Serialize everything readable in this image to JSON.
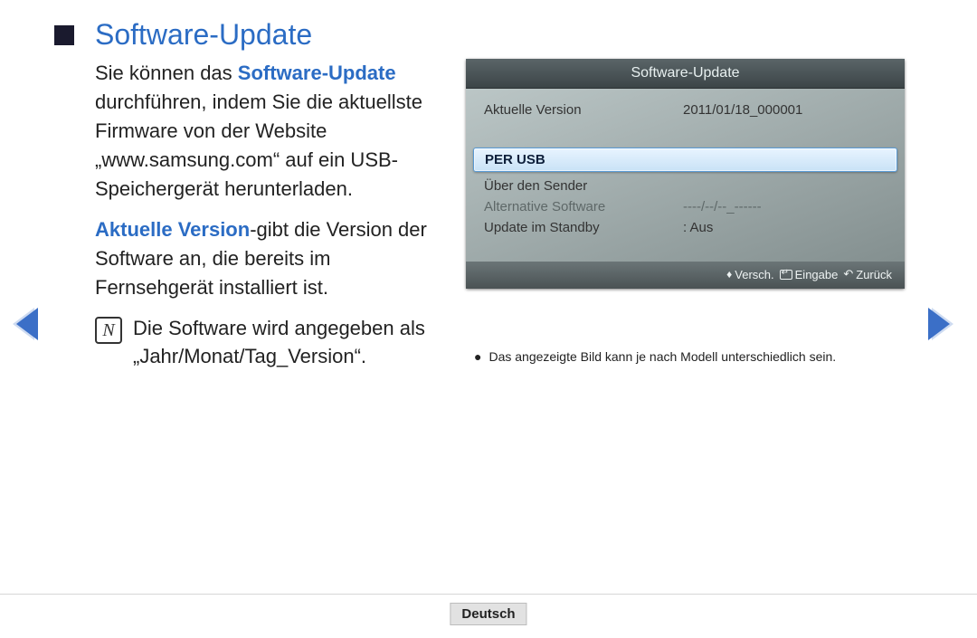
{
  "title": "Software-Update",
  "para1_prefix": "Sie können das ",
  "para1_hl": "Software-Update",
  "para1_suffix": " durchführen, indem Sie die aktuellste Firmware von der Website „www.samsung.com“ auf ein USB-Speichergerät herunterladen.",
  "para2_hl": "Aktuelle Version",
  "para2_suffix": "-gibt die Version der Software an, die bereits im Fernsehgerät installiert ist.",
  "note_icon": "N",
  "note_text": "Die Software wird angegeben als „Jahr/Monat/Tag_Version“.",
  "panel": {
    "header": "Software-Update",
    "curr_label": "Aktuelle Version",
    "curr_value": "2011/01/18_000001",
    "selected": "PER USB",
    "item2": "Über den Sender",
    "item3_label": "Alternative Software",
    "item3_value": "----/--/--_------",
    "item4_label": "Update im Standby",
    "item4_value": ": Aus",
    "foot_move": "Versch.",
    "foot_enter": "Eingabe",
    "foot_back": "Zurück"
  },
  "caption_bullet": "●",
  "caption_text": "Das angezeigte Bild kann je nach Modell unterschiedlich sein.",
  "lang": "Deutsch"
}
